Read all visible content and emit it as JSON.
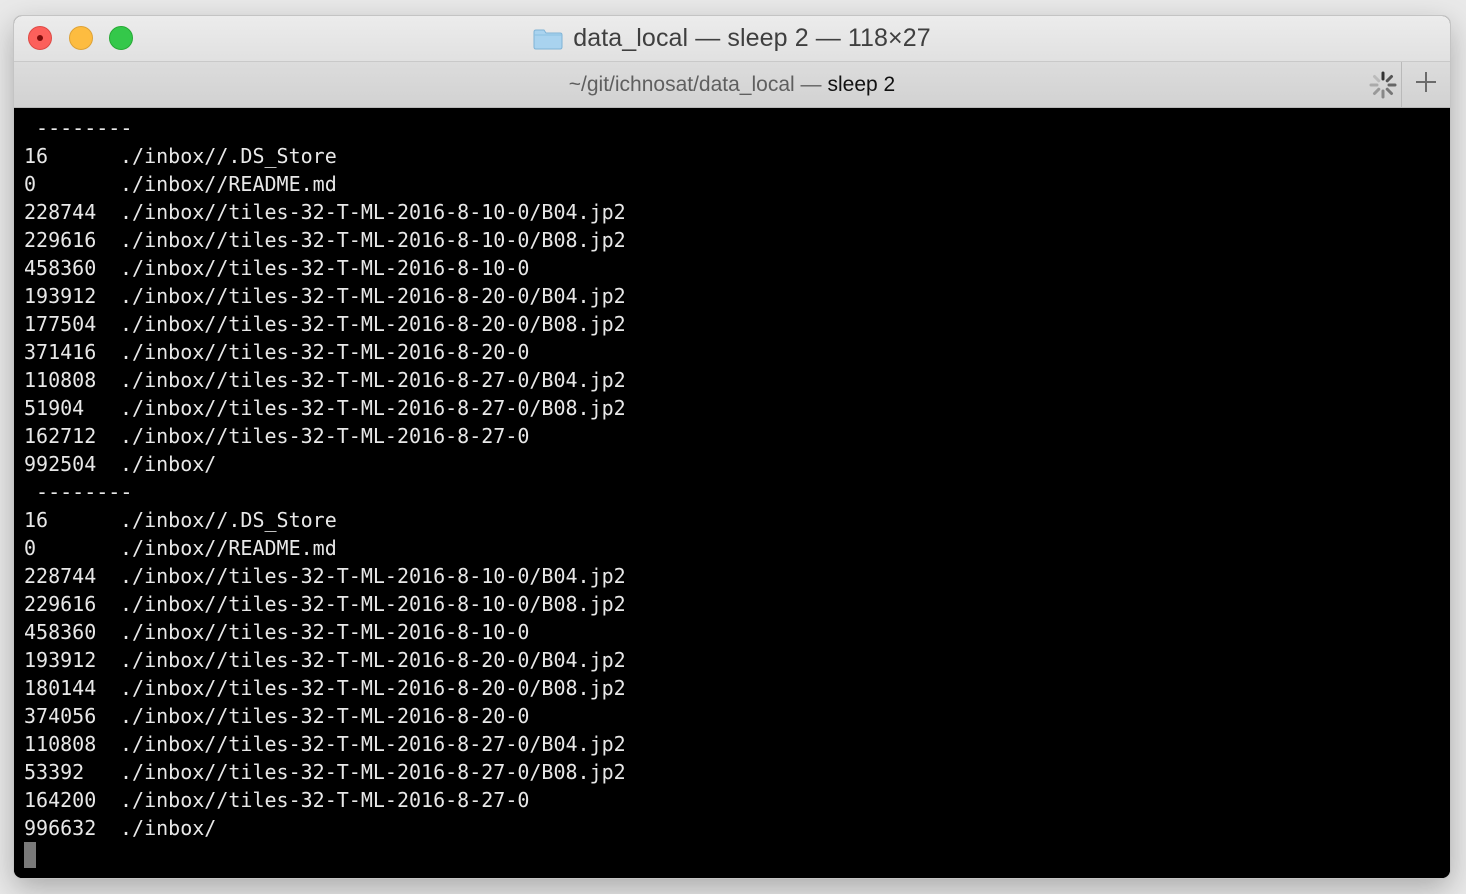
{
  "window": {
    "title": "data_local — sleep 2 — 118×27"
  },
  "tab": {
    "path": "~/git/ichnosat/data_local —",
    "process": "sleep 2"
  },
  "icons": {
    "folder": "folder-icon",
    "spinner": "activity-spinner-icon",
    "new_tab": "plus-icon"
  },
  "colors": {
    "close": "#fc605b",
    "minimize": "#fdbc40",
    "maximize": "#34c84a",
    "terminal_bg": "#000000",
    "terminal_fg": "#e8e8e8"
  },
  "terminal": {
    "lines": [
      {
        "sep": " --------"
      },
      {
        "size": "16",
        "path": "./inbox//.DS_Store"
      },
      {
        "size": "0",
        "path": "./inbox//README.md"
      },
      {
        "size": "228744",
        "path": "./inbox//tiles-32-T-ML-2016-8-10-0/B04.jp2"
      },
      {
        "size": "229616",
        "path": "./inbox//tiles-32-T-ML-2016-8-10-0/B08.jp2"
      },
      {
        "size": "458360",
        "path": "./inbox//tiles-32-T-ML-2016-8-10-0"
      },
      {
        "size": "193912",
        "path": "./inbox//tiles-32-T-ML-2016-8-20-0/B04.jp2"
      },
      {
        "size": "177504",
        "path": "./inbox//tiles-32-T-ML-2016-8-20-0/B08.jp2"
      },
      {
        "size": "371416",
        "path": "./inbox//tiles-32-T-ML-2016-8-20-0"
      },
      {
        "size": "110808",
        "path": "./inbox//tiles-32-T-ML-2016-8-27-0/B04.jp2"
      },
      {
        "size": "51904",
        "path": "./inbox//tiles-32-T-ML-2016-8-27-0/B08.jp2"
      },
      {
        "size": "162712",
        "path": "./inbox//tiles-32-T-ML-2016-8-27-0"
      },
      {
        "size": "992504",
        "path": "./inbox/"
      },
      {
        "sep": " --------"
      },
      {
        "size": "16",
        "path": "./inbox//.DS_Store"
      },
      {
        "size": "0",
        "path": "./inbox//README.md"
      },
      {
        "size": "228744",
        "path": "./inbox//tiles-32-T-ML-2016-8-10-0/B04.jp2"
      },
      {
        "size": "229616",
        "path": "./inbox//tiles-32-T-ML-2016-8-10-0/B08.jp2"
      },
      {
        "size": "458360",
        "path": "./inbox//tiles-32-T-ML-2016-8-10-0"
      },
      {
        "size": "193912",
        "path": "./inbox//tiles-32-T-ML-2016-8-20-0/B04.jp2"
      },
      {
        "size": "180144",
        "path": "./inbox//tiles-32-T-ML-2016-8-20-0/B08.jp2"
      },
      {
        "size": "374056",
        "path": "./inbox//tiles-32-T-ML-2016-8-20-0"
      },
      {
        "size": "110808",
        "path": "./inbox//tiles-32-T-ML-2016-8-27-0/B04.jp2"
      },
      {
        "size": "53392",
        "path": "./inbox//tiles-32-T-ML-2016-8-27-0/B08.jp2"
      },
      {
        "size": "164200",
        "path": "./inbox//tiles-32-T-ML-2016-8-27-0"
      },
      {
        "size": "996632",
        "path": "./inbox/"
      }
    ]
  }
}
